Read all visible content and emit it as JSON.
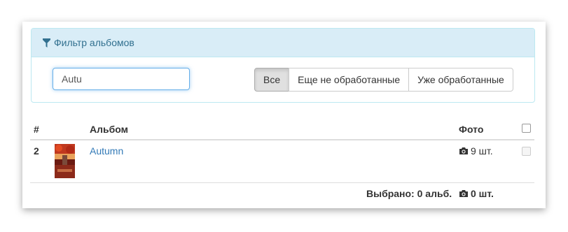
{
  "filter": {
    "title": "Фильтр альбомов",
    "search_value": "Autu",
    "buttons": [
      {
        "label": "Все",
        "active": true
      },
      {
        "label": "Еще не обработанные",
        "active": false
      },
      {
        "label": "Уже обработанные",
        "active": false
      }
    ]
  },
  "table": {
    "headers": {
      "num": "#",
      "album": "Альбом",
      "photo": "Фото"
    },
    "rows": [
      {
        "num": "2",
        "album": "Autumn",
        "photo_count": "9 шт."
      }
    ],
    "footer": {
      "selected_albums": "Выбрано: 0 альб.",
      "selected_photos": "0 шт."
    }
  },
  "colors": {
    "link": "#337ab7",
    "panel_heading": "#d9edf7",
    "panel_text": "#31708f"
  },
  "icons": {
    "filter": "filter-icon",
    "camera": "camera-icon"
  }
}
